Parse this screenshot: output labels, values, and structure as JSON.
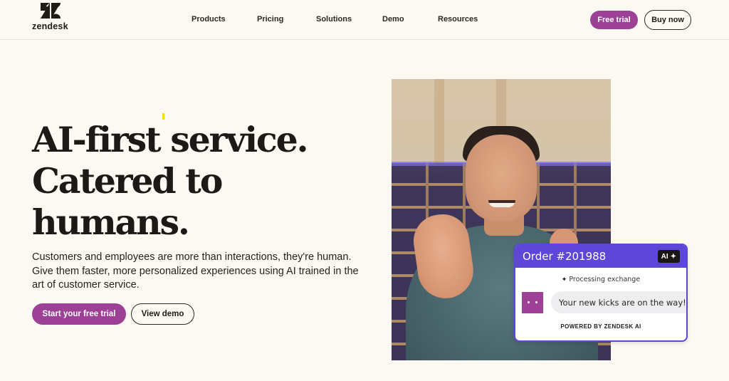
{
  "brand": {
    "name": "zendesk",
    "primary_color": "#9c4196",
    "card_accent_color": "#5d46d8",
    "background_color": "#fcf9f2"
  },
  "nav": {
    "items": [
      {
        "label": "Products"
      },
      {
        "label": "Pricing"
      },
      {
        "label": "Solutions"
      },
      {
        "label": "Demo"
      },
      {
        "label": "Resources"
      }
    ],
    "free_trial_label": "Free trial",
    "buy_now_label": "Buy now"
  },
  "hero": {
    "title_lines": [
      "AI-first service.",
      "Catered to",
      "humans."
    ],
    "subtitle": "Customers and employees are more than interactions, they're human. Give them faster, more personalized experiences using AI trained in the art of customer service.",
    "primary_cta": "Start your free trial",
    "secondary_cta": "View demo"
  },
  "chat_card": {
    "title": "Order #201988",
    "ai_badge": "AI",
    "ai_badge_icon": "sparkle-icon",
    "status": "Processing exchange",
    "status_icon": "sparkle-icon",
    "message": "Your new kicks are on the way!",
    "footer": "POWERED BY ZENDESK AI"
  },
  "image": {
    "description": "Smiling man making finger-heart gesture in front of sneaker shelves"
  }
}
